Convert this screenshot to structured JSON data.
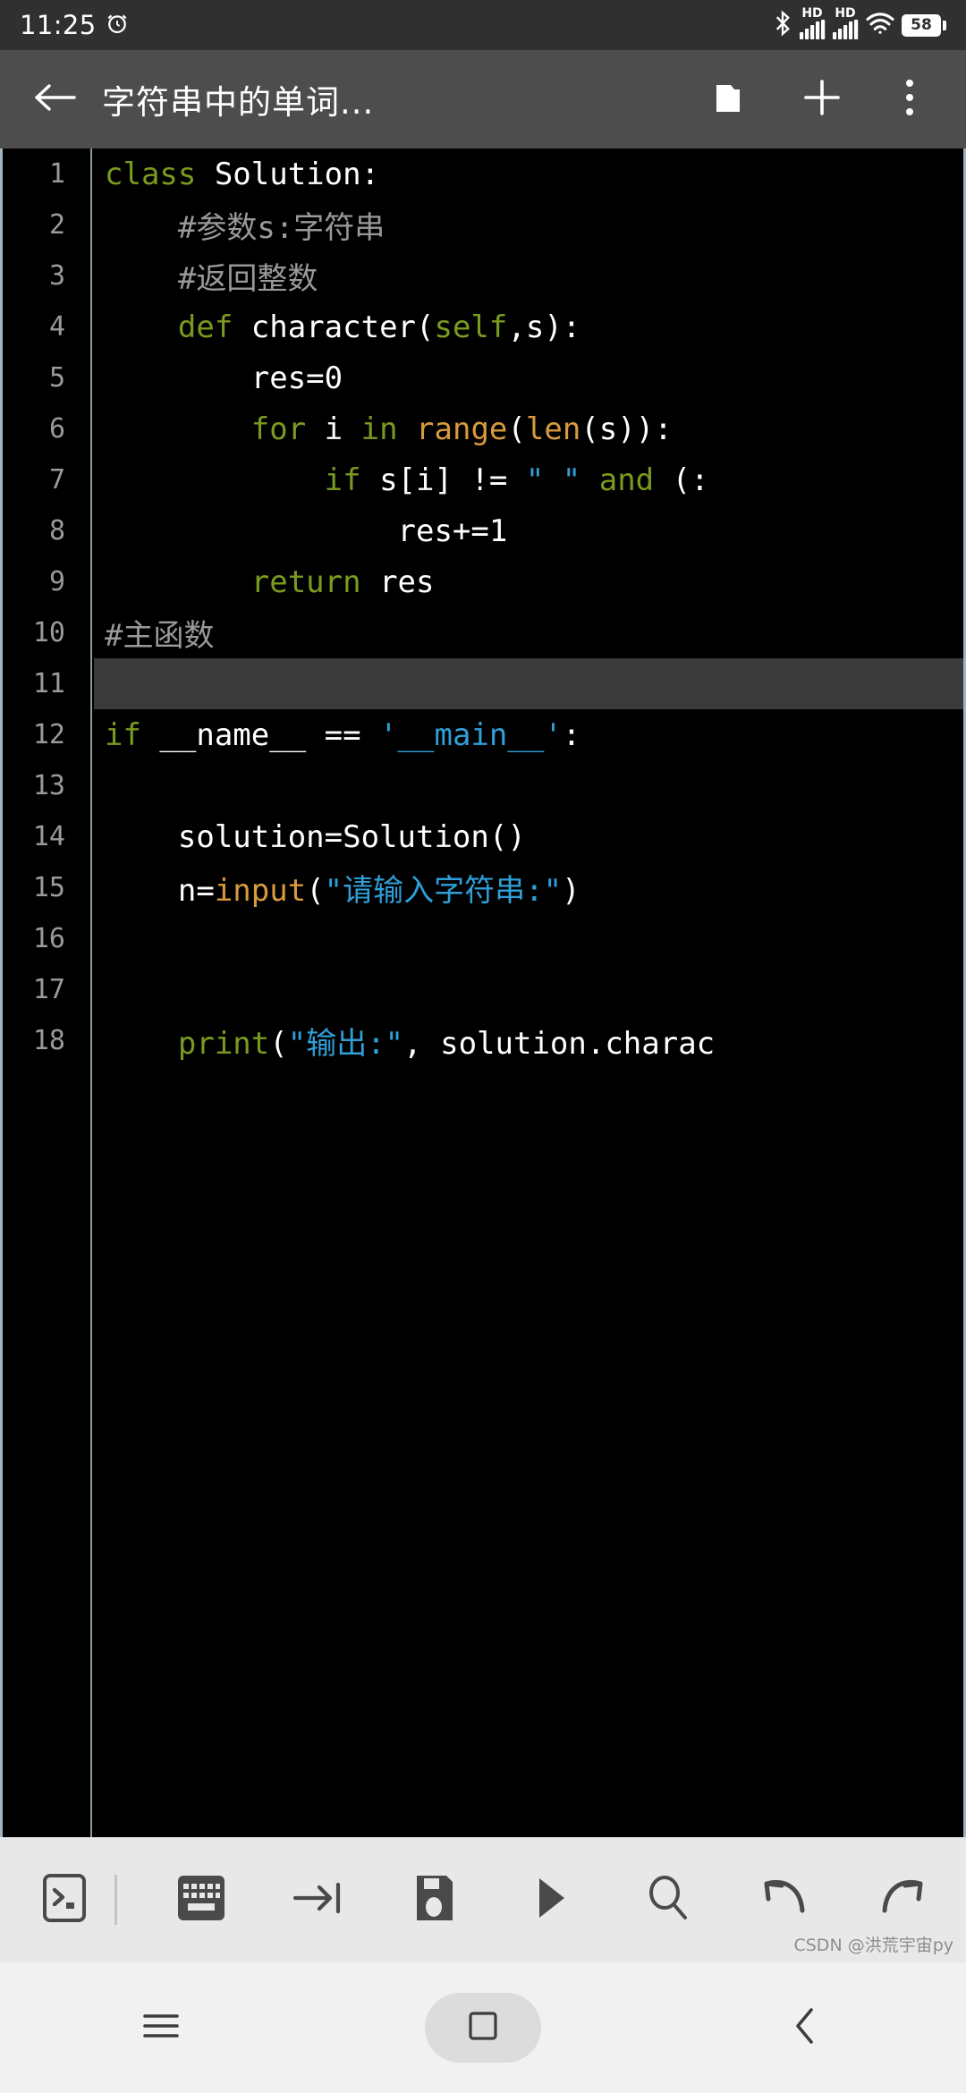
{
  "statusbar": {
    "time": "11:25",
    "alarm_icon": "alarm-icon",
    "bluetooth_icon": "bluetooth-icon",
    "hd_label_1": "HD",
    "hd_label_2": "HD",
    "signal_icon_1": "signal-bars-icon",
    "signal_icon_2": "signal-bars-icon",
    "wifi_icon": "wifi-icon",
    "battery_level": "58"
  },
  "appbar": {
    "back_icon": "back-arrow-icon",
    "title": "字符串中的单词...",
    "folder_icon": "folder-icon",
    "add_icon": "plus-icon",
    "overflow_icon": "more-vertical-icon"
  },
  "editor": {
    "current_line": 11,
    "colors": {
      "background": "#000000",
      "keyword": "#7a9b1f",
      "builtin": "#d99a3e",
      "string": "#2f9fd8",
      "comment": "#999999",
      "plain": "#ffffff",
      "line_number": "#9a9a9a",
      "current_line_bg": "#3b3b3b",
      "border": "#9fb3c0"
    },
    "lines": [
      {
        "n": 1,
        "tokens": [
          {
            "t": "class",
            "c": "kw"
          },
          {
            "t": " Solution:",
            "c": "pl"
          }
        ]
      },
      {
        "n": 2,
        "tokens": [
          {
            "t": "    #参数s:字符串",
            "c": "cmt"
          }
        ]
      },
      {
        "n": 3,
        "tokens": [
          {
            "t": "    #返回整数",
            "c": "cmt"
          }
        ]
      },
      {
        "n": 4,
        "tokens": [
          {
            "t": "    ",
            "c": "pl"
          },
          {
            "t": "def",
            "c": "kw"
          },
          {
            "t": " character(",
            "c": "pl"
          },
          {
            "t": "self",
            "c": "kw"
          },
          {
            "t": ",s):",
            "c": "pl"
          }
        ]
      },
      {
        "n": 5,
        "tokens": [
          {
            "t": "        res=0",
            "c": "pl"
          }
        ]
      },
      {
        "n": 6,
        "tokens": [
          {
            "t": "        ",
            "c": "pl"
          },
          {
            "t": "for",
            "c": "kw"
          },
          {
            "t": " i ",
            "c": "pl"
          },
          {
            "t": "in",
            "c": "kw"
          },
          {
            "t": " ",
            "c": "pl"
          },
          {
            "t": "range",
            "c": "bi"
          },
          {
            "t": "(",
            "c": "pl"
          },
          {
            "t": "len",
            "c": "bi"
          },
          {
            "t": "(s)):",
            "c": "pl"
          }
        ]
      },
      {
        "n": 7,
        "tokens": [
          {
            "t": "            ",
            "c": "pl"
          },
          {
            "t": "if",
            "c": "kw"
          },
          {
            "t": " s[i] != ",
            "c": "pl"
          },
          {
            "t": "\" \"",
            "c": "str"
          },
          {
            "t": " ",
            "c": "pl"
          },
          {
            "t": "and",
            "c": "kw"
          },
          {
            "t": " (:",
            "c": "pl"
          }
        ]
      },
      {
        "n": 8,
        "tokens": [
          {
            "t": "                res+=1",
            "c": "pl"
          }
        ]
      },
      {
        "n": 9,
        "tokens": [
          {
            "t": "        ",
            "c": "pl"
          },
          {
            "t": "return",
            "c": "kw"
          },
          {
            "t": " res",
            "c": "pl"
          }
        ]
      },
      {
        "n": 10,
        "tokens": [
          {
            "t": "#主函数",
            "c": "cmt"
          }
        ]
      },
      {
        "n": 11,
        "tokens": [
          {
            "t": "",
            "c": "pl"
          }
        ]
      },
      {
        "n": 12,
        "tokens": [
          {
            "t": "if",
            "c": "kw"
          },
          {
            "t": " __name__ == ",
            "c": "pl"
          },
          {
            "t": "'__main__'",
            "c": "str"
          },
          {
            "t": ":",
            "c": "pl"
          }
        ]
      },
      {
        "n": 13,
        "tokens": [
          {
            "t": "",
            "c": "pl"
          }
        ]
      },
      {
        "n": 14,
        "tokens": [
          {
            "t": "    solution=Solution()",
            "c": "pl"
          }
        ]
      },
      {
        "n": 15,
        "tokens": [
          {
            "t": "    n=",
            "c": "pl"
          },
          {
            "t": "input",
            "c": "bi"
          },
          {
            "t": "(",
            "c": "pl"
          },
          {
            "t": "\"请输入字符串:\"",
            "c": "str"
          },
          {
            "t": ")",
            "c": "pl"
          }
        ]
      },
      {
        "n": 16,
        "tokens": [
          {
            "t": "",
            "c": "pl"
          }
        ]
      },
      {
        "n": 17,
        "tokens": [
          {
            "t": "",
            "c": "pl"
          }
        ]
      },
      {
        "n": 18,
        "tokens": [
          {
            "t": "    ",
            "c": "pl"
          },
          {
            "t": "print",
            "c": "kw"
          },
          {
            "t": "(",
            "c": "pl"
          },
          {
            "t": "\"输出:\"",
            "c": "str"
          },
          {
            "t": ", solution.charac",
            "c": "pl"
          }
        ]
      }
    ]
  },
  "toolbar": {
    "buttons": [
      {
        "name": "console-button",
        "icon": "terminal-icon"
      },
      {
        "name": "keyboard-button",
        "icon": "keyboard-icon"
      },
      {
        "name": "indent-button",
        "icon": "tab-indent-icon"
      },
      {
        "name": "save-button",
        "icon": "floppy-save-icon"
      },
      {
        "name": "run-button",
        "icon": "play-icon"
      },
      {
        "name": "search-button",
        "icon": "magnifier-icon"
      },
      {
        "name": "undo-button",
        "icon": "undo-arrow-icon"
      },
      {
        "name": "redo-button",
        "icon": "redo-arrow-icon"
      }
    ]
  },
  "navbar": {
    "recents_icon": "hamburger-recents-icon",
    "home_icon": "home-square-icon",
    "back_icon": "back-chevron-icon"
  },
  "watermark": "CSDN @洪荒宇宙py"
}
